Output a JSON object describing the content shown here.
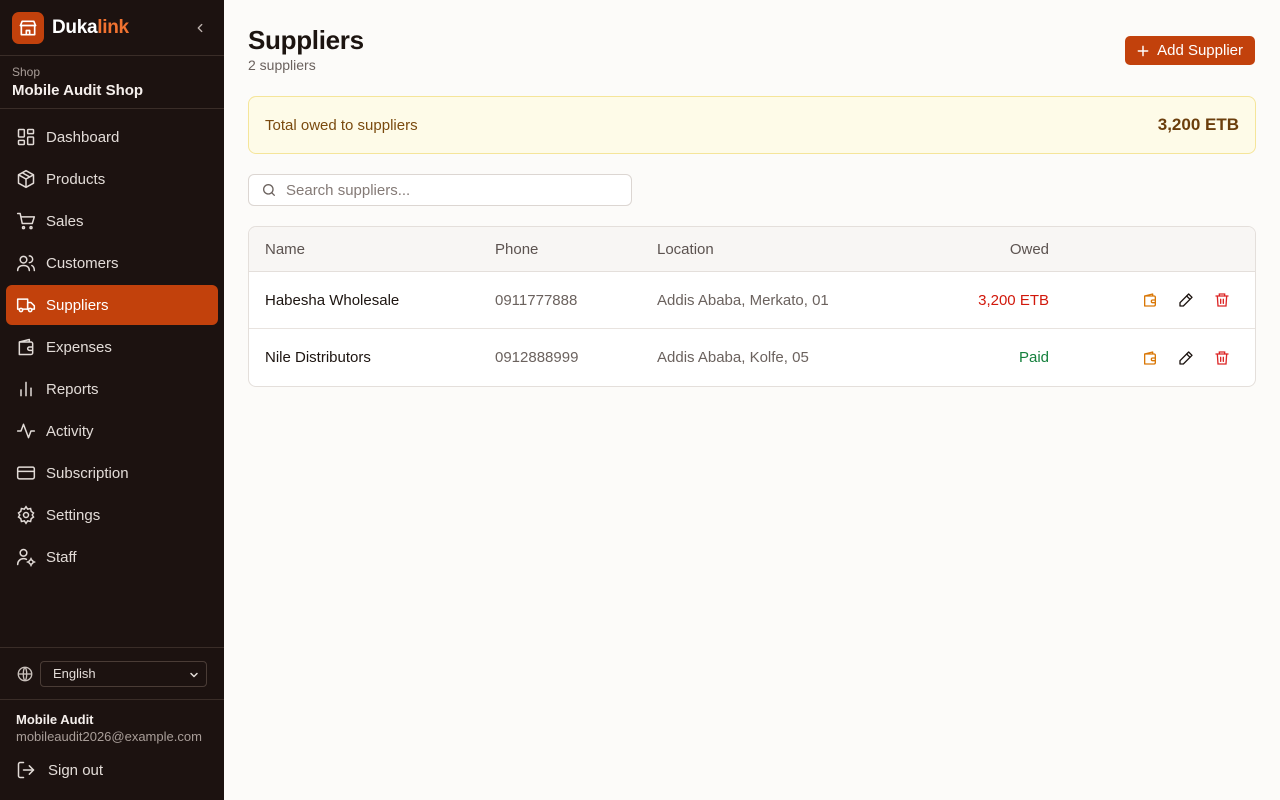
{
  "brand": {
    "name_part1": "Duka",
    "name_part2": "link"
  },
  "shop": {
    "label": "Shop",
    "name": "Mobile Audit Shop"
  },
  "nav": [
    {
      "label": "Dashboard",
      "icon": "dashboard-icon"
    },
    {
      "label": "Products",
      "icon": "package-icon"
    },
    {
      "label": "Sales",
      "icon": "cart-icon"
    },
    {
      "label": "Customers",
      "icon": "users-icon"
    },
    {
      "label": "Suppliers",
      "icon": "truck-icon",
      "active": true
    },
    {
      "label": "Expenses",
      "icon": "wallet-icon"
    },
    {
      "label": "Reports",
      "icon": "bar-chart-icon"
    },
    {
      "label": "Activity",
      "icon": "activity-icon"
    },
    {
      "label": "Subscription",
      "icon": "credit-card-icon"
    },
    {
      "label": "Settings",
      "icon": "gear-icon"
    },
    {
      "label": "Staff",
      "icon": "user-cog-icon"
    }
  ],
  "language": {
    "selected": "English"
  },
  "user": {
    "name": "Mobile Audit",
    "email": "mobileaudit2026@example.com",
    "signout_label": "Sign out"
  },
  "page": {
    "title": "Suppliers",
    "subtitle": "2 suppliers",
    "add_label": "Add Supplier"
  },
  "summary": {
    "label": "Total owed to suppliers",
    "value": "3,200 ETB"
  },
  "search": {
    "placeholder": "Search suppliers...",
    "value": ""
  },
  "table": {
    "headers": {
      "name": "Name",
      "phone": "Phone",
      "location": "Location",
      "owed": "Owed"
    },
    "rows": [
      {
        "name": "Habesha Wholesale",
        "phone": "0911777888",
        "location": "Addis Ababa, Merkato, 01",
        "owed": "3,200 ETB",
        "owed_status": "owing"
      },
      {
        "name": "Nile Distributors",
        "phone": "0912888999",
        "location": "Addis Ababa, Kolfe, 05",
        "owed": "Paid",
        "owed_status": "paid"
      }
    ]
  },
  "colors": {
    "accent": "#c2410c",
    "sidebar_bg": "#1c1210",
    "owed": "#d1180b",
    "paid": "#15803d",
    "banner_bg": "#fefbe8"
  }
}
